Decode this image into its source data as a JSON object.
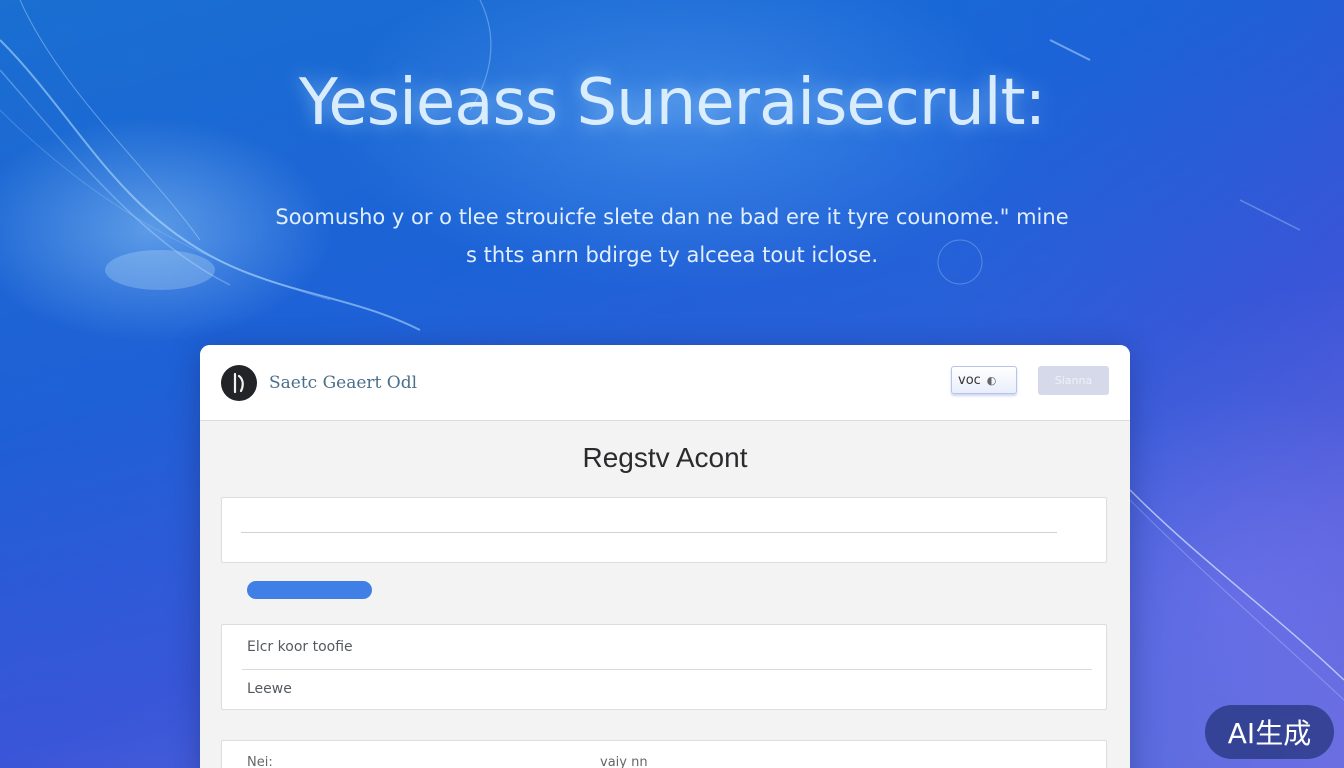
{
  "hero": {
    "title": "Yesieass Suneraisecrult:",
    "subtitle_line1": "Soomusho y or o tlee strouicfe slete dan ne bad ere it tyre counome.\" mine",
    "subtitle_line2": "s thts anrn bdirge ty alceea tout iclose."
  },
  "card": {
    "brand_name": "Saetc Geaert Odl",
    "lang_select_value": "voc",
    "signin_label": "Sianna",
    "form_title": "Regstv Acont",
    "options": [
      {
        "label": "Elcr koor toofie"
      },
      {
        "label": "Leewe"
      }
    ],
    "bottom_row": {
      "label": "Nei:",
      "value": "vaiy nn"
    }
  },
  "badge": {
    "label": "AI生成"
  },
  "colors": {
    "primary_blue": "#3f7fe6",
    "bg_start": "#1a6fd1",
    "bg_end": "#6b6ee0",
    "brand_text": "#4a6f8a"
  },
  "icons": {
    "brand": "brand-logo-icon",
    "lang_chevron": "chevron-down-icon"
  }
}
